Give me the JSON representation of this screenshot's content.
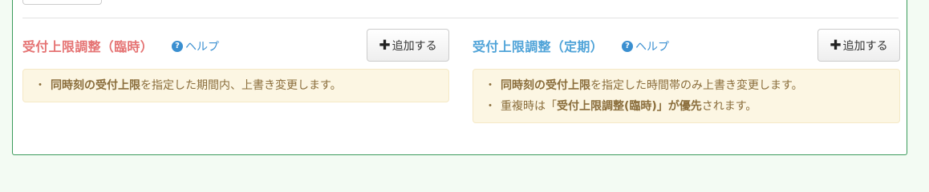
{
  "colors": {
    "accent_red": "#e57373",
    "accent_blue": "#4fa3d8",
    "link": "#3a8fd0",
    "note_bg": "#fcf6e3",
    "note_text": "#8a6d3b"
  },
  "temporary": {
    "title": "受付上限調整（臨時）",
    "help_label": "ヘルプ",
    "help_icon": "question-circle-icon",
    "add_label": "追加する",
    "add_icon": "plus-icon",
    "notes": [
      {
        "bullet": "・",
        "bold": "同時刻の受付上限",
        "rest": "を指定した期間内、上書き変更します。"
      }
    ]
  },
  "regular": {
    "title": "受付上限調整（定期）",
    "help_label": "ヘルプ",
    "help_icon": "question-circle-icon",
    "add_label": "追加する",
    "add_icon": "plus-icon",
    "notes": [
      {
        "bullet": "・",
        "bold": "同時刻の受付上限",
        "rest": "を指定した時間帯のみ上書き変更します。"
      },
      {
        "bullet": "・",
        "pre": "重複時は「",
        "bold": "受付上限調整(臨時)」が優先",
        "rest": "されます。"
      }
    ]
  }
}
